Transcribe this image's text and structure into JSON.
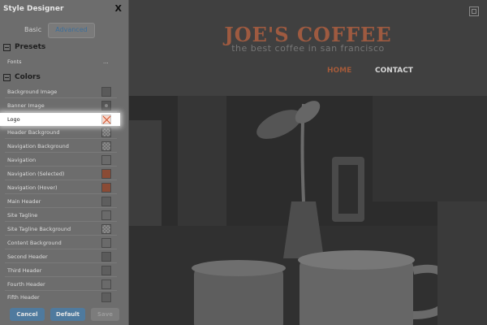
{
  "designer": {
    "title": "Style Designer",
    "close_label": "X",
    "tabs": [
      {
        "label": "Basic"
      },
      {
        "label": "Advanced"
      }
    ],
    "presets": {
      "heading": "Presets",
      "fonts_label": "Fonts",
      "fonts_more": "..."
    },
    "colors": {
      "heading": "Colors",
      "items": [
        {
          "label": "Background Image",
          "swatch": "#5a5a5a"
        },
        {
          "label": "Banner Image",
          "swatch": "image"
        },
        {
          "label": "Logo",
          "swatch": "logo"
        },
        {
          "label": "Header Background",
          "swatch": "transparent"
        },
        {
          "label": "Navigation Background",
          "swatch": "transparent"
        },
        {
          "label": "Navigation",
          "swatch": "#6a6a6a"
        },
        {
          "label": "Navigation (Selected)",
          "swatch": "#8a4b35"
        },
        {
          "label": "Navigation (Hover)",
          "swatch": "#8a4b35"
        },
        {
          "label": "Main Header",
          "swatch": "#5e5e5e"
        },
        {
          "label": "Site Tagline",
          "swatch": "#6a6a6a"
        },
        {
          "label": "Site Tagline Background",
          "swatch": "transparent"
        },
        {
          "label": "Content Background",
          "swatch": "#6a6a6a"
        },
        {
          "label": "Second Header",
          "swatch": "#5a5a5a"
        },
        {
          "label": "Third Header",
          "swatch": "#5e5e5e"
        },
        {
          "label": "Fourth Header",
          "swatch": "#6a6a6a"
        },
        {
          "label": "Fifth Header",
          "swatch": "#5e5e5e"
        }
      ]
    },
    "buttons": {
      "cancel": "Cancel",
      "default": "Default",
      "save": "Save"
    }
  },
  "site": {
    "title": "JOE'S COFFEE",
    "tagline": "the best coffee in san francisco",
    "nav": [
      {
        "label": "HOME"
      },
      {
        "label": "CONTACT"
      }
    ]
  }
}
